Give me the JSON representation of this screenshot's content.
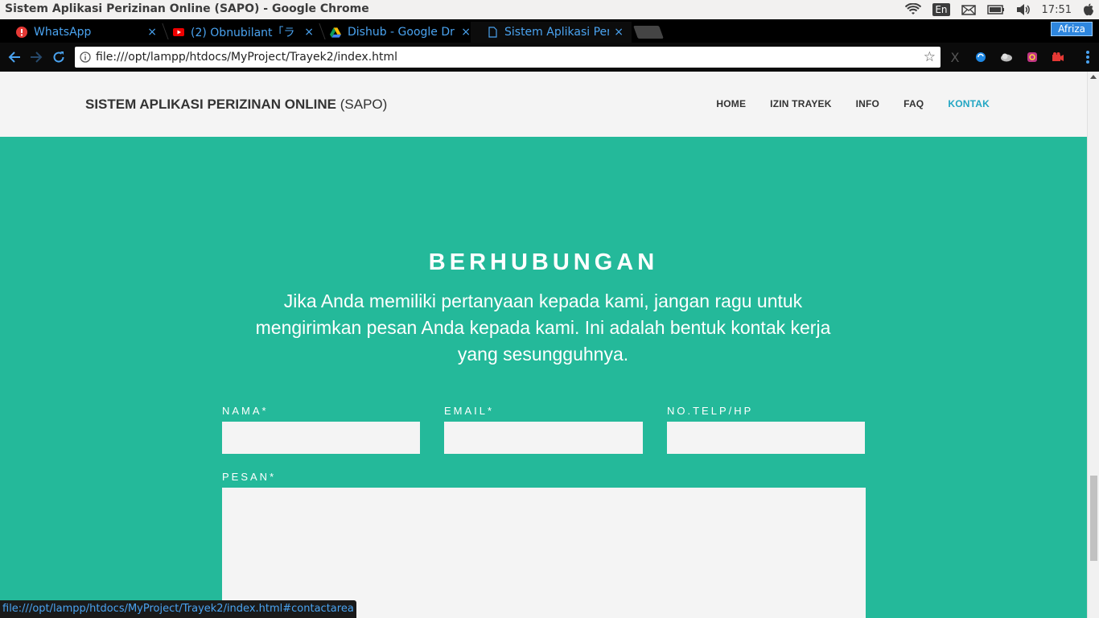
{
  "os_bar": {
    "window_title": "Sistem Aplikasi Perizinan Online (SAPO) - Google Chrome",
    "language": "En",
    "time": "17:51",
    "icons": [
      "wifi-icon",
      "keyboard-layout-icon",
      "mail-icon",
      "battery-icon",
      "volume-icon",
      "apple-icon"
    ]
  },
  "browser": {
    "tabs": [
      {
        "label": "WhatsApp",
        "icon": "whatsapp-icon"
      },
      {
        "label": "(2) Obnubilant「ラ",
        "icon": "youtube-icon"
      },
      {
        "label": "Dishub - Google Dr",
        "icon": "google-drive-icon"
      },
      {
        "label": "Sistem Aplikasi Peri",
        "icon": "page-icon",
        "active": true
      }
    ],
    "close_glyph": "×",
    "profile_name": "Afriza",
    "url": "file:///opt/lampp/htdocs/MyProject/Trayek2/index.html",
    "status_url": "file:///opt/lampp/htdocs/MyProject/Trayek2/index.html#contactarea",
    "extension_icons": [
      "x-extension-icon",
      "sync-extension-icon",
      "cloud-extension-icon",
      "instagram-extension-icon",
      "camera-extension-icon"
    ]
  },
  "site": {
    "brand_bold": "SISTEM APLIKASI PERIZINAN ONLINE",
    "brand_light": " (SAPO)",
    "nav": [
      {
        "label": "HOME",
        "active": false
      },
      {
        "label": "IZIN TRAYEK",
        "active": false
      },
      {
        "label": "INFO",
        "active": false
      },
      {
        "label": "FAQ",
        "active": false
      },
      {
        "label": "KONTAK",
        "active": true
      }
    ],
    "contact": {
      "title": "BERHUBUNGAN",
      "intro": "Jika Anda memiliki pertanyaan kepada kami, jangan ragu untuk mengirimkan pesan Anda kepada kami. Ini adalah bentuk kontak kerja yang sesungguhnya.",
      "fields": {
        "name_label": "NAMA*",
        "name_value": "",
        "email_label": "EMAIL*",
        "email_value": "",
        "phone_label": "NO.TELP/HP",
        "phone_value": "",
        "message_label": "PESAN*",
        "message_value": ""
      }
    }
  },
  "colors": {
    "accent_green": "#24b99a",
    "header_bg": "#f4f4f4",
    "active_nav": "#22a6c3",
    "chrome_link_blue": "#4aa3f0"
  }
}
